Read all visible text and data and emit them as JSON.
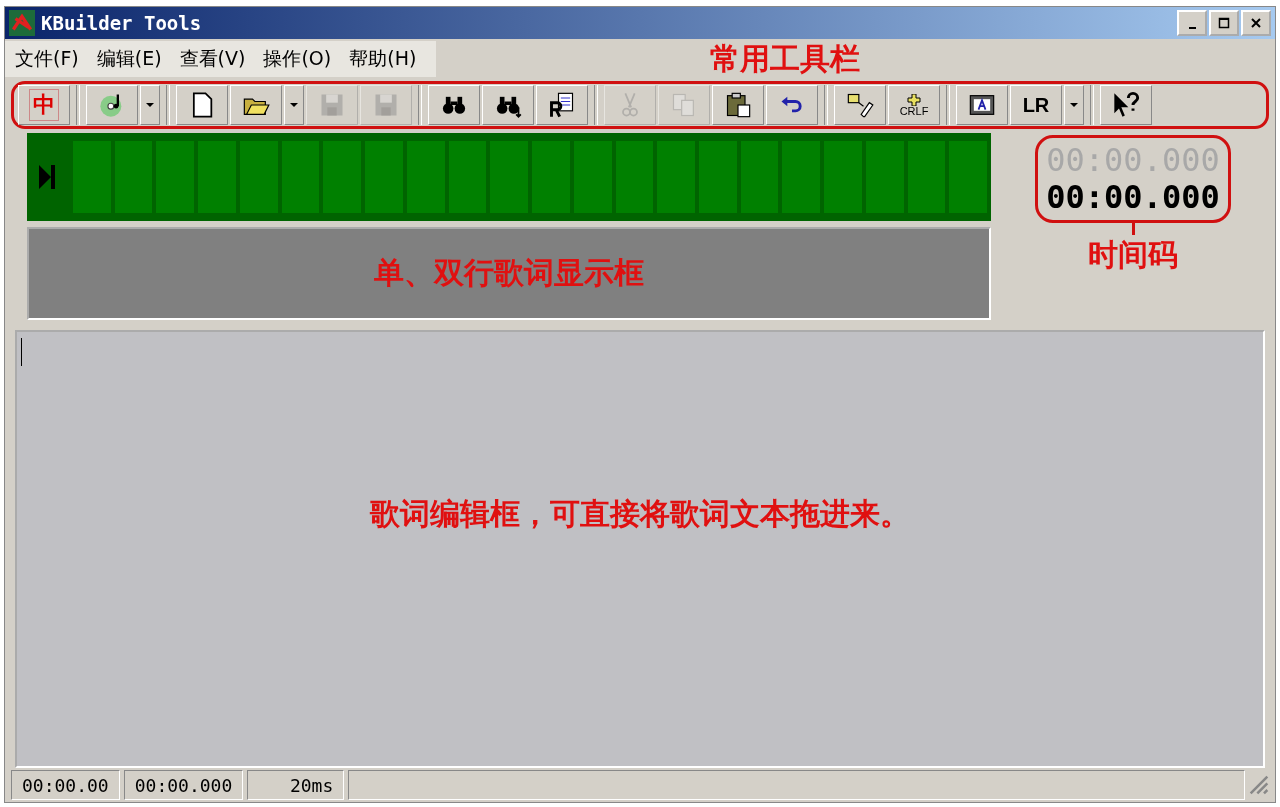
{
  "window": {
    "title": "KBuilder Tools"
  },
  "menu": [
    "文件(F)",
    "编辑(E)",
    "查看(V)",
    "操作(O)",
    "帮助(H)"
  ],
  "toolbar": [
    {
      "buttons": [
        {
          "kind": "chinese",
          "label": "中",
          "disabled": false
        }
      ]
    },
    {
      "buttons": [
        {
          "kind": "cd",
          "disabled": false
        },
        {
          "kind": "dropdown",
          "disabled": false
        }
      ]
    },
    {
      "buttons": [
        {
          "kind": "new",
          "disabled": false
        },
        {
          "kind": "open",
          "disabled": false
        },
        {
          "kind": "dropdown",
          "disabled": false
        },
        {
          "kind": "save",
          "disabled": true
        },
        {
          "kind": "save-as",
          "disabled": true
        }
      ]
    },
    {
      "buttons": [
        {
          "kind": "find",
          "disabled": false
        },
        {
          "kind": "find-next",
          "disabled": false
        },
        {
          "kind": "replace",
          "disabled": false
        }
      ]
    },
    {
      "buttons": [
        {
          "kind": "cut",
          "disabled": true
        },
        {
          "kind": "copy",
          "disabled": true
        },
        {
          "kind": "paste",
          "disabled": false
        },
        {
          "kind": "undo",
          "disabled": false
        }
      ]
    },
    {
      "buttons": [
        {
          "kind": "tag",
          "disabled": false
        },
        {
          "kind": "crlf",
          "label": "CRLF",
          "disabled": false
        }
      ]
    },
    {
      "buttons": [
        {
          "kind": "display",
          "disabled": false
        },
        {
          "kind": "text",
          "label": "LR",
          "disabled": false
        },
        {
          "kind": "dropdown",
          "disabled": false
        }
      ]
    },
    {
      "buttons": [
        {
          "kind": "help",
          "disabled": false
        }
      ]
    }
  ],
  "annotations": {
    "toolbar": "常用工具栏",
    "lyric_display": "单、双行歌词显示框",
    "timecode": "时间码",
    "editor": "歌词编辑框，可直接将歌词文本拖进来。"
  },
  "timecode": {
    "dim": "00:00.000",
    "main": "00:00.000"
  },
  "status_bar": [
    "00:00.00",
    "00:00.000",
    "20ms"
  ]
}
